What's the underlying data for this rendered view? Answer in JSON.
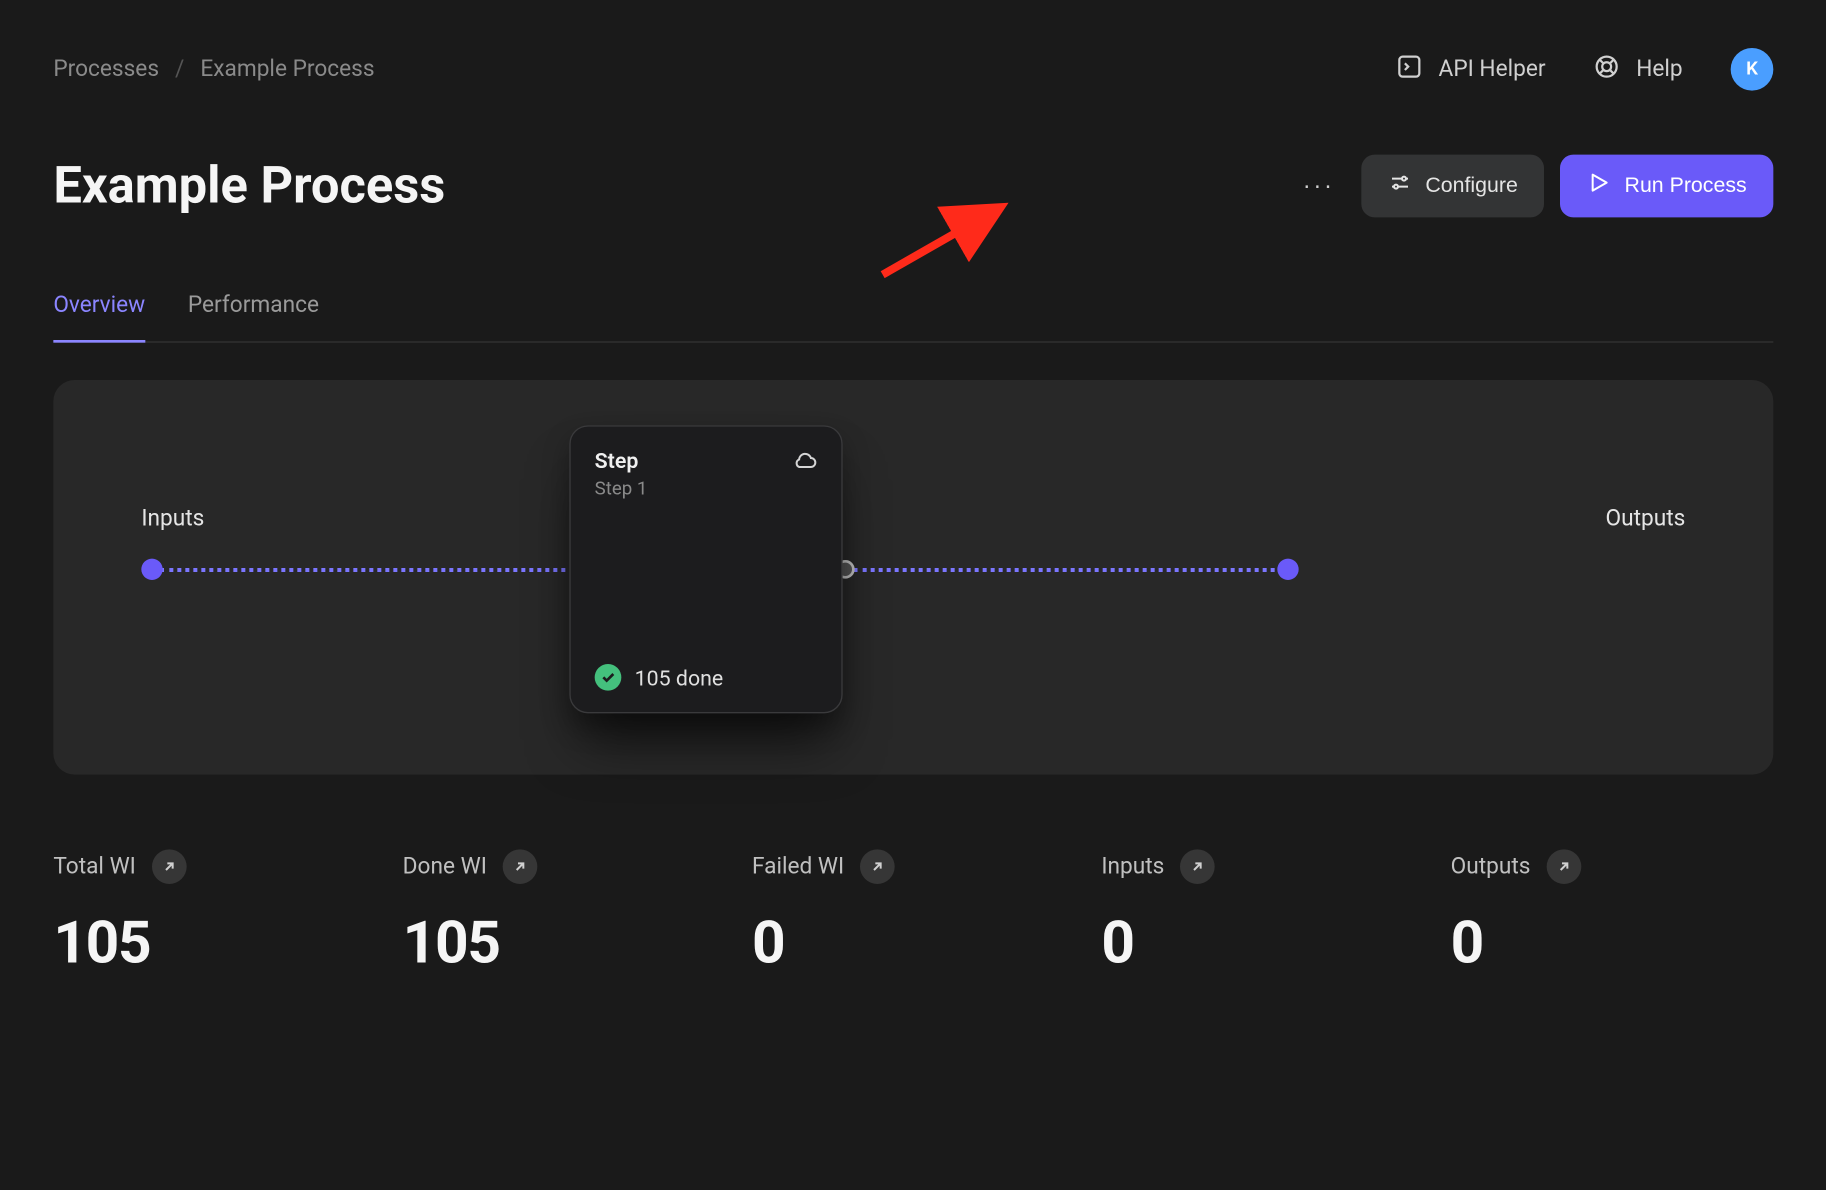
{
  "breadcrumb": {
    "root": "Processes",
    "current": "Example Process"
  },
  "header": {
    "api_helper": "API Helper",
    "help": "Help",
    "avatar_initial": "K"
  },
  "title": "Example Process",
  "actions": {
    "configure": "Configure",
    "run": "Run Process"
  },
  "tabs": {
    "overview": "Overview",
    "performance": "Performance"
  },
  "flow": {
    "inputs_label": "Inputs",
    "outputs_label": "Outputs",
    "step": {
      "type": "Step",
      "name": "Step 1",
      "done_text": "105 done"
    }
  },
  "stats": [
    {
      "label": "Total WI",
      "value": "105"
    },
    {
      "label": "Done WI",
      "value": "105"
    },
    {
      "label": "Failed WI",
      "value": "0"
    },
    {
      "label": "Inputs",
      "value": "0"
    },
    {
      "label": "Outputs",
      "value": "0"
    }
  ]
}
